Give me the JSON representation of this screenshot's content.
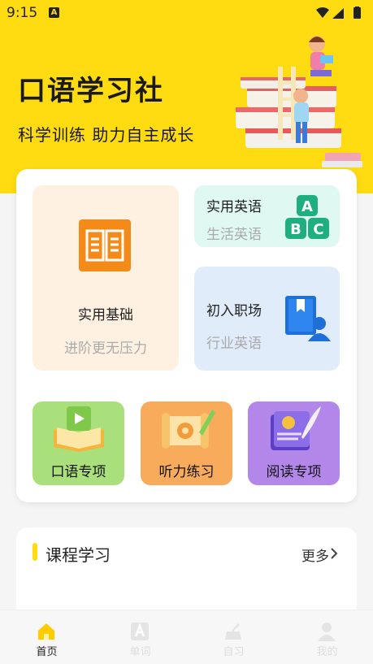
{
  "status_bar": {
    "time": "9:15",
    "notification": "A"
  },
  "hero": {
    "title": "口语学习社",
    "slogan": "科学训练  助力自主成长"
  },
  "tiles": {
    "basics": {
      "title": "实用基础",
      "subtitle": "进阶更无压力"
    },
    "english": {
      "title": "实用英语",
      "subtitle": "生活英语",
      "blocks": [
        "A",
        "B",
        "C"
      ]
    },
    "work": {
      "title": "初入职场",
      "subtitle": "行业英语"
    },
    "oral": {
      "label": "口语专项"
    },
    "listening": {
      "label": "听力练习"
    },
    "reading": {
      "label": "阅读专项"
    }
  },
  "course": {
    "title": "课程学习",
    "more": "更多"
  },
  "tabbar": {
    "items": [
      {
        "label": "首页",
        "icon": "home-icon",
        "active": true
      },
      {
        "label": "单词",
        "icon": "word-icon",
        "active": false
      },
      {
        "label": "自习",
        "icon": "study-icon",
        "active": false
      },
      {
        "label": "我的",
        "icon": "profile-icon",
        "active": false
      }
    ]
  },
  "colors": {
    "accent": "#ffdb12",
    "basics_bg": "#fff1e2",
    "english_bg": "#e0f8f2",
    "work_bg": "#e1ecfb",
    "oral_bg": "#a9e07b",
    "listening_bg": "#f9ab5c",
    "reading_bg": "#b387ea"
  }
}
